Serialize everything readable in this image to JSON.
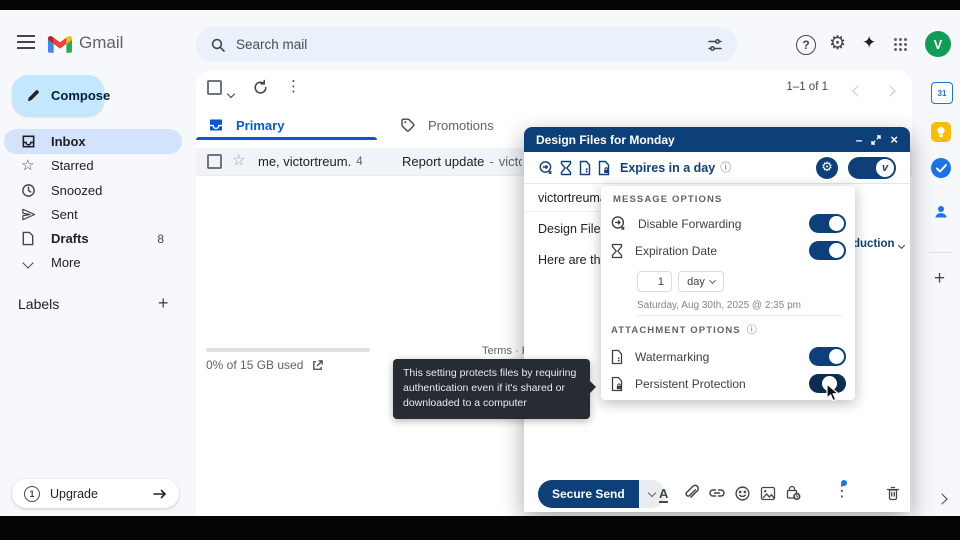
{
  "header": {
    "app_name": "Gmail",
    "search_placeholder": "Search mail",
    "avatar_letter": "V"
  },
  "sidebar": {
    "compose_label": "Compose",
    "items": [
      {
        "label": "Inbox",
        "count": ""
      },
      {
        "label": "Starred",
        "count": ""
      },
      {
        "label": "Snoozed",
        "count": ""
      },
      {
        "label": "Sent",
        "count": ""
      },
      {
        "label": "Drafts",
        "count": "8"
      },
      {
        "label": "More",
        "count": ""
      }
    ],
    "labels_title": "Labels",
    "upgrade_label": "Upgrade"
  },
  "mail_list": {
    "pagination": "1–1 of 1",
    "tab_primary": "Primary",
    "tab_promotions": "Promotions",
    "row": {
      "senders": "me, victortreum.",
      "thread_count": "4",
      "subject": "Report update",
      "separator": "-",
      "snippet": "victortreu"
    },
    "storage_text": "0% of 15 GB used",
    "terms_text": "Terms · Pr"
  },
  "compose": {
    "title": "Design Files for Monday",
    "controls": {
      "minimize": "–",
      "close": "×"
    },
    "expires_label": "Expires in a day",
    "recipient": "victortreumar",
    "subject": "Design Files f",
    "body_line": "Here are the fil",
    "clipped_dropdown": "duction",
    "send_label": "Secure Send",
    "toggle_brand_letter": "v"
  },
  "options_panel": {
    "message_options_title": "MESSAGE OPTIONS",
    "message_toggles": [
      {
        "label": "Disable Forwarding",
        "state": "on"
      },
      {
        "label": "Expiration Date",
        "state": "on"
      }
    ],
    "expiry_value": "1",
    "expiry_unit": "day",
    "expiry_datetime": "Saturday, Aug 30th, 2025 @ 2:35 pm",
    "attachment_options_title": "ATTACHMENT OPTIONS",
    "attachment_toggles": [
      {
        "label": "Watermarking",
        "state": "on"
      },
      {
        "label": "Persistent Protection",
        "state": "switching"
      }
    ]
  },
  "tooltip": {
    "text": "This setting protects files by requiring authentication even if it's shared or downloaded to a computer"
  },
  "colors": {
    "virtru_navy": "#0d4078",
    "gmail_blue": "#0b57d0",
    "selected_pill": "#d3e3fd",
    "compose_pill": "#c2e7ff",
    "search_bg": "#eaf1fb",
    "app_bg": "#f6f8fc",
    "tooltip_bg": "#272c33",
    "avatar_green": "#119c57"
  }
}
